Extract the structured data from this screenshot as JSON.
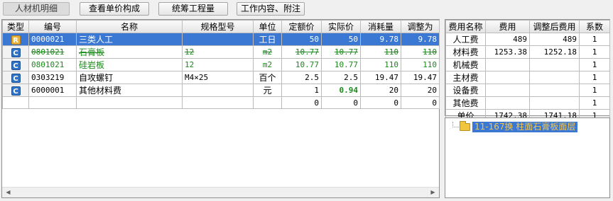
{
  "toolbar": {
    "tabs": [
      {
        "label": "人材机明细"
      },
      {
        "label": "查看单价构成"
      },
      {
        "label": "统筹工程量"
      },
      {
        "label": "工作内容、附注"
      }
    ]
  },
  "materials": {
    "columns": [
      "类型",
      "编号",
      "名称",
      "规格型号",
      "单位",
      "定额价",
      "实际价",
      "消耗量",
      "调整为"
    ],
    "rows": [
      {
        "type": "R",
        "code": "0000021",
        "name": "三类人工",
        "spec": "",
        "unit": "工日",
        "quota_price": "50",
        "actual_price": "50",
        "consumption": "9.78",
        "adjusted": "9.78"
      },
      {
        "type": "C",
        "code": "0801021",
        "name": "石膏板",
        "spec": "12",
        "unit": "m2",
        "quota_price": "10.77",
        "actual_price": "10.77",
        "consumption": "110",
        "adjusted": "110"
      },
      {
        "type": "C",
        "code": "0801021",
        "name": "硅岩板",
        "spec": "12",
        "unit": "m2",
        "quota_price": "10.77",
        "actual_price": "10.77",
        "consumption": "110",
        "adjusted": "110"
      },
      {
        "type": "C",
        "code": "0303219",
        "name": "自攻螺钉",
        "spec": "M4×25",
        "unit": "百个",
        "quota_price": "2.5",
        "actual_price": "2.5",
        "consumption": "19.47",
        "adjusted": "19.47"
      },
      {
        "type": "C",
        "code": "6000001",
        "name": "其他材料费",
        "spec": "",
        "unit": "元",
        "quota_price": "1",
        "actual_price": "0.94",
        "consumption": "20",
        "adjusted": "20"
      },
      {
        "type": "",
        "code": "",
        "name": "",
        "spec": "",
        "unit": "",
        "quota_price": "0",
        "actual_price": "0",
        "consumption": "0",
        "adjusted": "0"
      }
    ]
  },
  "costs": {
    "columns": [
      "费用名称",
      "费用",
      "调整后费用",
      "系数"
    ],
    "rows": [
      {
        "name": "人工费",
        "cost": "489",
        "adjusted": "489",
        "coef": "1"
      },
      {
        "name": "材料费",
        "cost": "1253.38",
        "adjusted": "1252.18",
        "coef": "1"
      },
      {
        "name": "机械费",
        "cost": "",
        "adjusted": "",
        "coef": "1"
      },
      {
        "name": "主材费",
        "cost": "",
        "adjusted": "",
        "coef": "1"
      },
      {
        "name": "设备费",
        "cost": "",
        "adjusted": "",
        "coef": "1"
      },
      {
        "name": "其他费",
        "cost": "",
        "adjusted": "",
        "coef": "1"
      },
      {
        "name": "单价",
        "cost": "1742.38",
        "adjusted": "1741.18",
        "coef": "1"
      }
    ]
  },
  "tree": {
    "item_label": "11-167换 柱面石膏板面层"
  },
  "colors": {
    "selection": "#3a78d4",
    "replaced_text": "#1a8a1a",
    "badge_R": "#e9b43c",
    "badge_C": "#2f74c8"
  }
}
